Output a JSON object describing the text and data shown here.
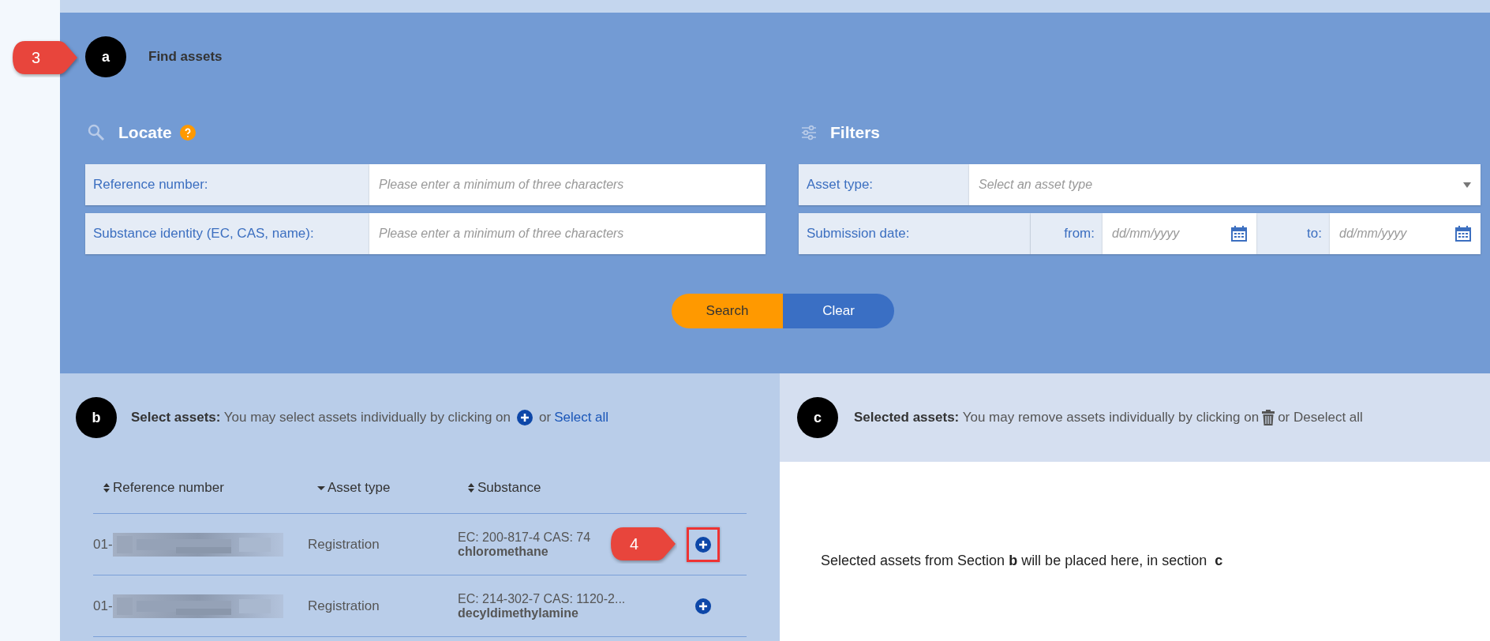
{
  "annotations": [
    {
      "label": "3"
    },
    {
      "label": "4"
    }
  ],
  "find": {
    "badge": "a",
    "title": "Find assets"
  },
  "locate": {
    "title": "Locate",
    "fields": [
      {
        "label": "Reference number:",
        "placeholder": "Please enter a minimum of three characters"
      },
      {
        "label": "Substance identity (EC, CAS, name):",
        "placeholder": "Please enter a minimum of three characters"
      }
    ]
  },
  "filters": {
    "title": "Filters",
    "asset_type": {
      "label": "Asset type:",
      "placeholder": "Select an asset type"
    },
    "submission_date": {
      "label": "Submission date:",
      "from_label": "from:",
      "from_placeholder": "dd/mm/yyyy",
      "to_label": "to:",
      "to_placeholder": "dd/mm/yyyy"
    }
  },
  "buttons": [
    {
      "label": "Search",
      "kind": "primary"
    },
    {
      "label": "Clear",
      "kind": "secondary"
    }
  ],
  "select": {
    "badge": "b",
    "intro": "**Select assets:** You may select assets individually by clicking on",
    "or": "or",
    "link": "Select all"
  },
  "table": {
    "columns": [
      {
        "label": "Reference number",
        "kind": "sortable"
      },
      {
        "label": "Asset type",
        "kind": "sorted"
      },
      {
        "label": "Substance",
        "kind": "sortable"
      }
    ],
    "rows": [
      {
        "reference": "01-",
        "asset_type": "Registration",
        "identifiers": "EC: 200-817-4 CAS: 74",
        "name": "chloromethane",
        "highlighted": true
      },
      {
        "reference": "01-",
        "asset_type": "Registration",
        "identifiers": "EC: 214-302-7 CAS: 1120-2...",
        "name": "decyldimethylamine",
        "highlighted": false
      }
    ]
  },
  "selected": {
    "badge": "c",
    "intro": "**Selected assets:** You may remove assets individually by clicking on",
    "after": "or Deselect all",
    "placeholder": "Selected assets from Section **b** will be placed here, in section  **c**"
  }
}
